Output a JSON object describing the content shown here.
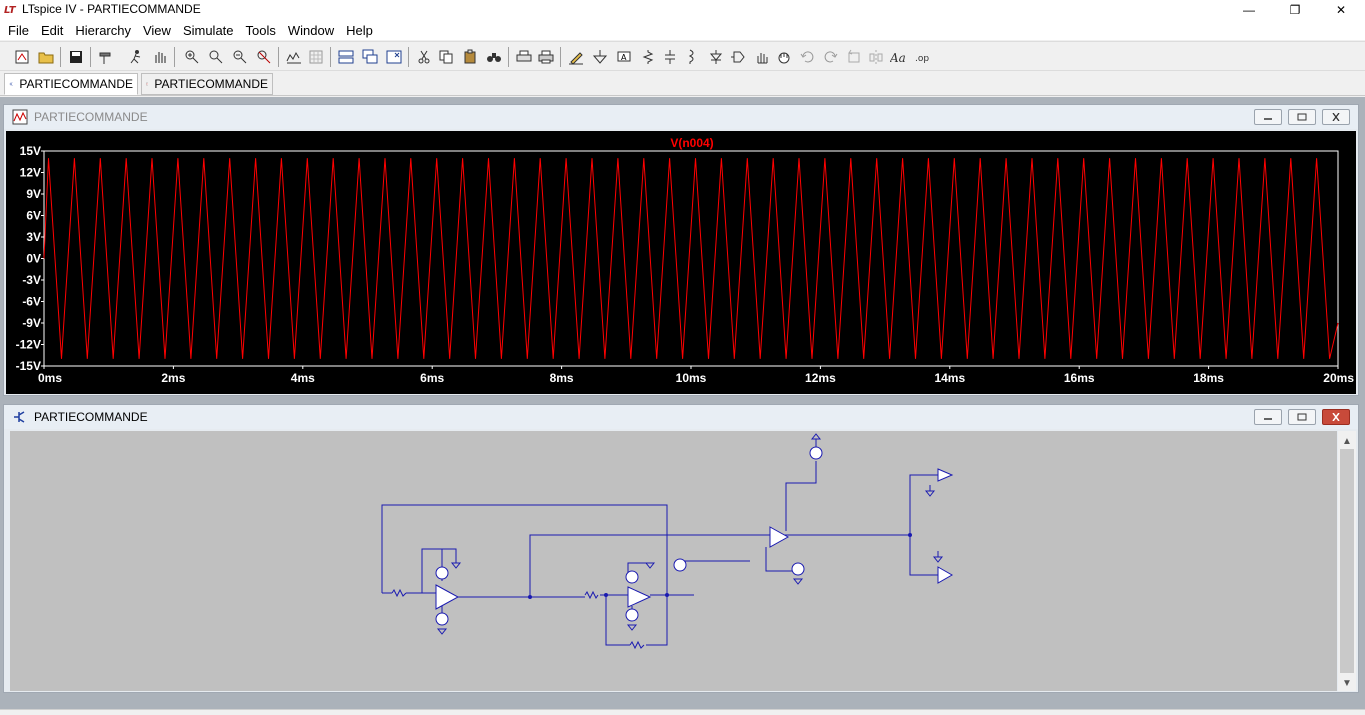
{
  "app": {
    "title": "LTspice IV - PARTIECOMMANDE"
  },
  "window_controls": {
    "minimize": "—",
    "maximize": "❐",
    "close": "✕"
  },
  "menu": [
    "File",
    "Edit",
    "Hierarchy",
    "View",
    "Simulate",
    "Tools",
    "Window",
    "Help"
  ],
  "tabs": [
    {
      "label": "PARTIECOMMANDE",
      "icon": "schematic-icon"
    },
    {
      "label": "PARTIECOMMANDE",
      "icon": "waveform-icon"
    }
  ],
  "plot_window": {
    "title": "PARTIECOMMANDE",
    "icon": "waveform-icon"
  },
  "schematic_window": {
    "title": "PARTIECOMMANDE",
    "icon": "schematic-icon"
  },
  "chart_data": {
    "type": "line",
    "title": "V(n004)",
    "xlabel": "",
    "ylabel": "",
    "xlim": [
      0,
      20
    ],
    "ylim": [
      -15,
      15
    ],
    "x_ticks": [
      "0ms",
      "2ms",
      "4ms",
      "6ms",
      "8ms",
      "10ms",
      "12ms",
      "14ms",
      "16ms",
      "18ms",
      "20ms"
    ],
    "y_ticks": [
      "15V",
      "12V",
      "9V",
      "6V",
      "3V",
      "0V",
      "-3V",
      "-6V",
      "-9V",
      "-12V",
      "-15V"
    ],
    "grid": false,
    "series": [
      {
        "name": "V(n004)",
        "color": "#ff0000",
        "waveform": "triangle",
        "period_ms": 0.4,
        "min_V": -14,
        "max_V": 14,
        "cycles": 50
      }
    ]
  },
  "colors": {
    "plot_bg": "#000000",
    "trace": "#ff0000",
    "axis_text": "#ffffff",
    "schematic_bg": "#c0c0c0",
    "wire": "#0000aa"
  }
}
